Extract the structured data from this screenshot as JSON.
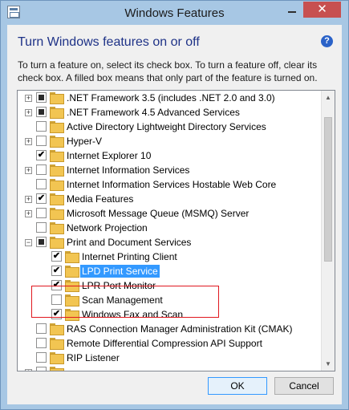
{
  "window": {
    "title": "Windows Features",
    "close_glyph": "✕",
    "icons": {
      "app": "windows-features-icon",
      "minimize": "minimize-icon",
      "close": "close-icon"
    }
  },
  "dialog": {
    "heading": "Turn Windows features on or off",
    "description": "To turn a feature on, select its check box. To turn a feature off, clear its check box. A filled box means that only part of the feature is turned on.",
    "help_glyph": "?",
    "help_icon": "help-icon"
  },
  "feature_list": {
    "scroll_up_glyph": "▲",
    "scroll_down_glyph": "▼",
    "scroll_position": 0.12,
    "items": [
      {
        "label": ".NET Framework 3.5 (includes .NET 2.0 and 3.0)",
        "level": 0,
        "expandable": true,
        "state": "partial",
        "selected": false
      },
      {
        "label": ".NET Framework 4.5 Advanced Services",
        "level": 0,
        "expandable": true,
        "state": "partial",
        "selected": false
      },
      {
        "label": "Active Directory Lightweight Directory Services",
        "level": 0,
        "expandable": false,
        "state": "unchecked",
        "selected": false
      },
      {
        "label": "Hyper-V",
        "level": 0,
        "expandable": true,
        "state": "unchecked",
        "selected": false
      },
      {
        "label": "Internet Explorer 10",
        "level": 0,
        "expandable": false,
        "state": "checked",
        "selected": false
      },
      {
        "label": "Internet Information Services",
        "level": 0,
        "expandable": true,
        "state": "unchecked",
        "selected": false
      },
      {
        "label": "Internet Information Services Hostable Web Core",
        "level": 0,
        "expandable": false,
        "state": "unchecked",
        "selected": false
      },
      {
        "label": "Media Features",
        "level": 0,
        "expandable": true,
        "state": "checked",
        "selected": false
      },
      {
        "label": "Microsoft Message Queue (MSMQ) Server",
        "level": 0,
        "expandable": true,
        "state": "unchecked",
        "selected": false
      },
      {
        "label": "Network Projection",
        "level": 0,
        "expandable": false,
        "state": "unchecked",
        "selected": false
      },
      {
        "label": "Print and Document Services",
        "level": 0,
        "expandable": true,
        "expanded": true,
        "state": "partial",
        "selected": false
      },
      {
        "label": "Internet Printing Client",
        "level": 1,
        "expandable": false,
        "state": "checked",
        "selected": false
      },
      {
        "label": "LPD Print Service",
        "level": 1,
        "expandable": false,
        "state": "checked",
        "selected": true
      },
      {
        "label": "LPR Port Monitor",
        "level": 1,
        "expandable": false,
        "state": "checked",
        "selected": false
      },
      {
        "label": "Scan Management",
        "level": 1,
        "expandable": false,
        "state": "unchecked",
        "selected": false
      },
      {
        "label": "Windows Fax and Scan",
        "level": 1,
        "expandable": false,
        "state": "checked",
        "selected": false
      },
      {
        "label": "RAS Connection Manager Administration Kit (CMAK)",
        "level": 0,
        "expandable": false,
        "state": "unchecked",
        "selected": false
      },
      {
        "label": "Remote Differential Compression API Support",
        "level": 0,
        "expandable": false,
        "state": "unchecked",
        "selected": false
      },
      {
        "label": "RIP Listener",
        "level": 0,
        "expandable": false,
        "state": "unchecked",
        "selected": false
      },
      {
        "label": "",
        "level": 0,
        "expandable": true,
        "state": "unchecked",
        "selected": false
      }
    ]
  },
  "buttons": {
    "ok_label": "OK",
    "cancel_label": "Cancel"
  },
  "colors": {
    "title_bar": "#a7c7e4",
    "close_button": "#c75050",
    "heading_text": "#1e3287",
    "selection": "#3399ff",
    "annotation_box": "#e0181f",
    "folder": "#f2c552"
  }
}
